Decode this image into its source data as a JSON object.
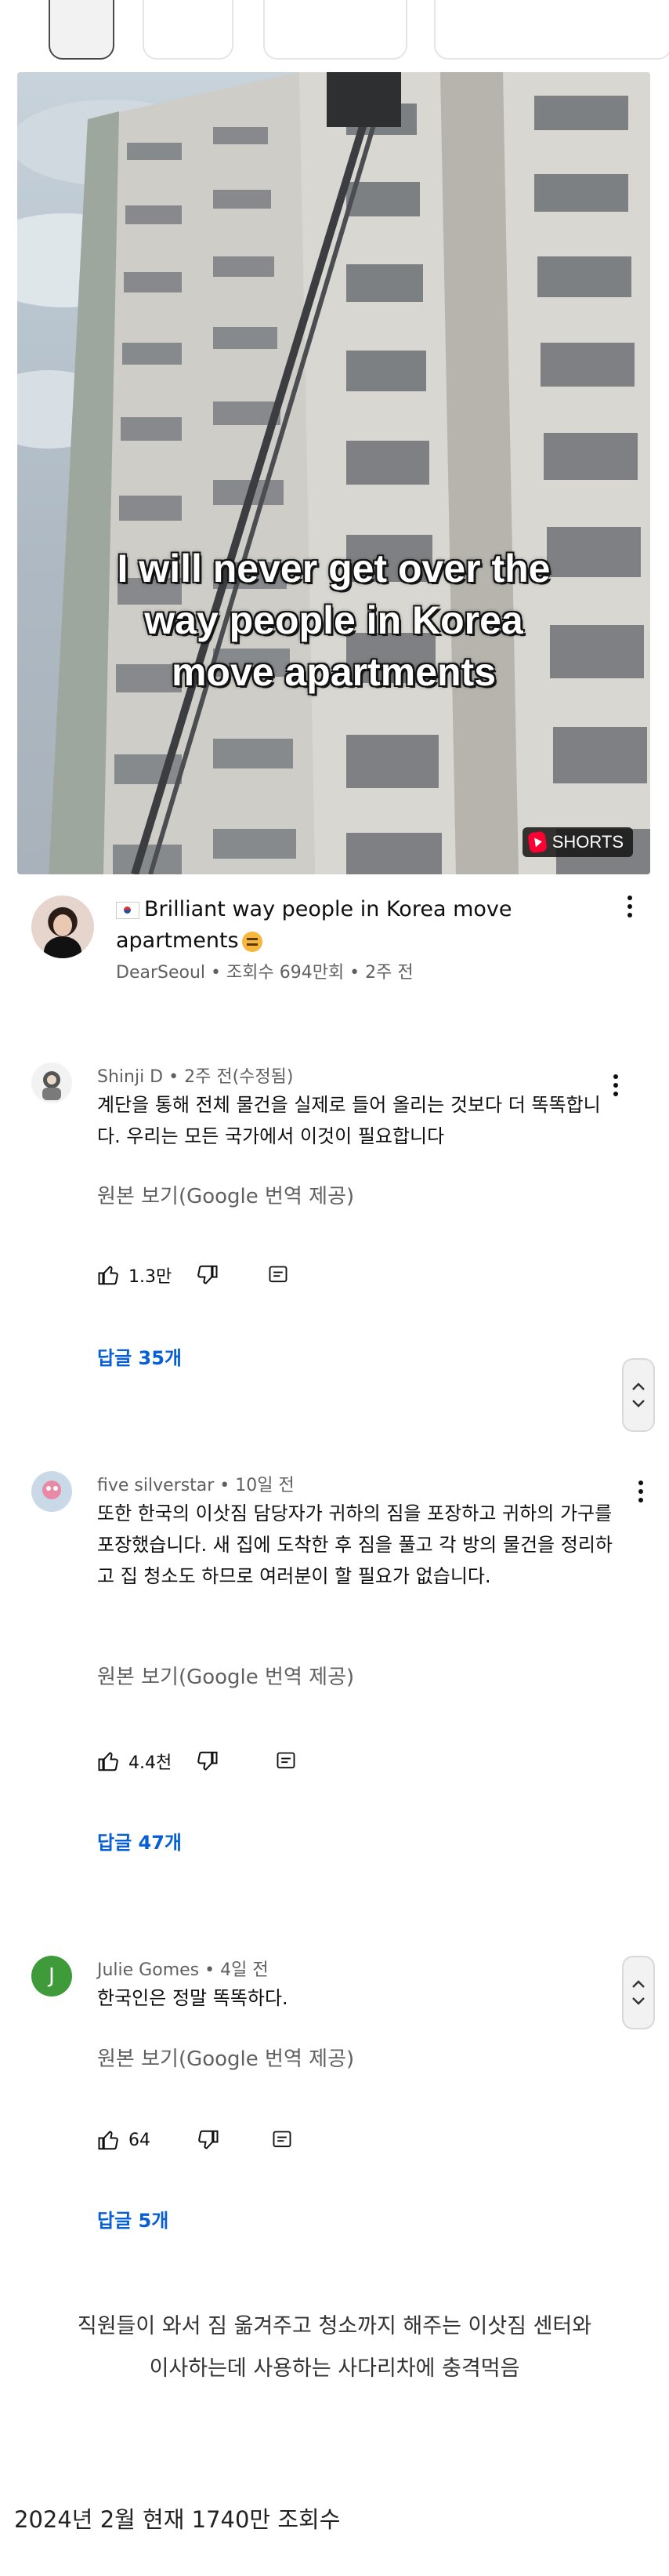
{
  "video": {
    "caption_lines": [
      "I will never get over the",
      "way people in Korea",
      "move apartments"
    ],
    "shorts_badge": "SHORTS",
    "title": "Brilliant way people in Korea move apartments",
    "channel": "DearSeoul",
    "views": "조회수 694만회",
    "age": "2주 전",
    "flag_icon": "south-korea-flag",
    "emoji_icon": "grimacing-face"
  },
  "comments": [
    {
      "author": "Shinji D",
      "age": "2주 전(수정됨)",
      "text": "계단을 통해 전체 물건을 실제로 들어 올리는 것보다 더 똑똑합니다. 우리는 모든 국가에서 이것이 필요합니다",
      "original": "원본 보기(Google 번역 제공)",
      "likes": "1.3만",
      "replies": "답글 35개"
    },
    {
      "author": "five silverstar",
      "age": "10일 전",
      "text": "또한 한국의 이삿짐 담당자가 귀하의 짐을 포장하고 귀하의 가구를 포장했습니다. 새 집에 도착한 후 짐을 풀고 각 방의 물건을 정리하고 집 청소도 하므로 여러분이 할 필요가 없습니다.",
      "original": "원본 보기(Google 번역 제공)",
      "likes": "4.4천",
      "replies": "답글 47개"
    },
    {
      "author": "Julie Gomes",
      "age": "4일 전",
      "avatar_letter": "J",
      "text": "한국인은 정말 똑똑하다.",
      "original": "원본 보기(Google 번역 제공)",
      "likes": "64",
      "replies": "답글 5개"
    }
  ],
  "post": {
    "line1": "직원들이 와서 짐 옮겨주고 청소까지 해주는 이삿짐 센터와",
    "line2": "이사하는데 사용하는 사다리차에 충격먹음",
    "footer": "2024년 2월 현재 1740만 조회수"
  },
  "colors": {
    "link_blue": "#065fd4",
    "secondary_text": "#606060",
    "shorts_red": "#ff0033",
    "julie_avatar_green": "#3f9a3a"
  }
}
